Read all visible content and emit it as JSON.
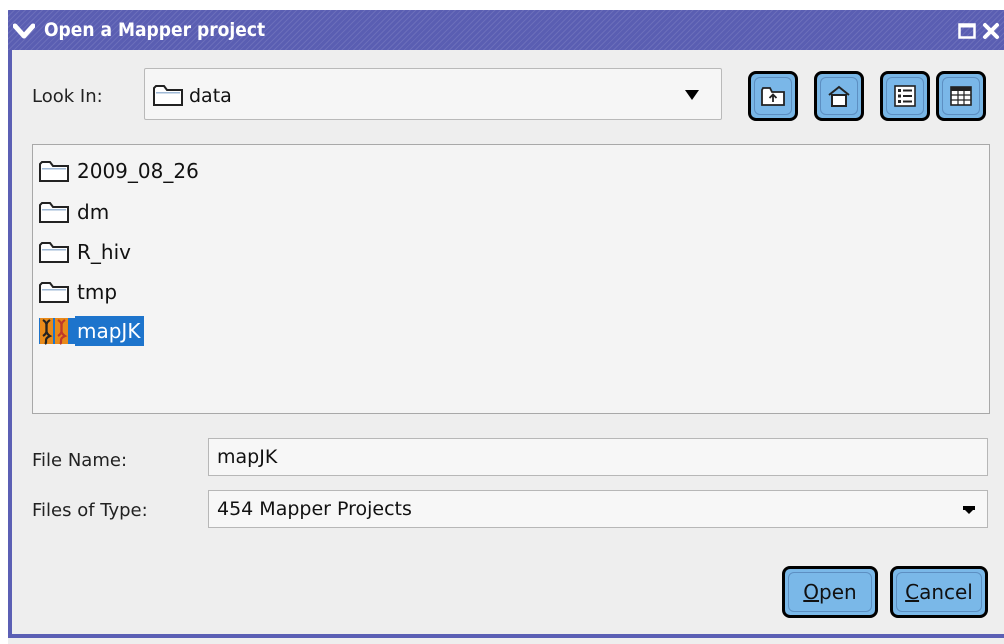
{
  "window": {
    "title": "Open a Mapper project",
    "icons": {
      "menu": "chevron-down-icon",
      "maximize": "maximize-icon",
      "close": "close-icon"
    }
  },
  "look_in": {
    "label": "Look In:",
    "value": "data",
    "toolbar": [
      {
        "name": "up-one-level-icon"
      },
      {
        "name": "home-icon"
      },
      {
        "name": "list-view-icon"
      },
      {
        "name": "details-view-icon"
      }
    ]
  },
  "files": [
    {
      "name": "2009_08_26",
      "icon": "folder-icon",
      "selected": false
    },
    {
      "name": "dm",
      "icon": "folder-icon",
      "selected": false
    },
    {
      "name": "R_hiv",
      "icon": "folder-icon",
      "selected": false
    },
    {
      "name": "tmp",
      "icon": "folder-icon",
      "selected": false
    },
    {
      "name": "mapJK",
      "icon": "mapper-project-icon",
      "selected": true
    }
  ],
  "file_name": {
    "label": "File Name:",
    "value": "mapJK"
  },
  "file_type": {
    "label": "Files of Type:",
    "value": "454 Mapper Projects"
  },
  "buttons": {
    "open": {
      "label": "Open",
      "mnemonic": "O",
      "rest": "pen"
    },
    "cancel": {
      "label": "Cancel",
      "mnemonic": "C",
      "rest": "ancel"
    }
  },
  "colors": {
    "titlebar": "#5a5eb2",
    "button": "#7ab8e8",
    "selection": "#1d74cc"
  }
}
